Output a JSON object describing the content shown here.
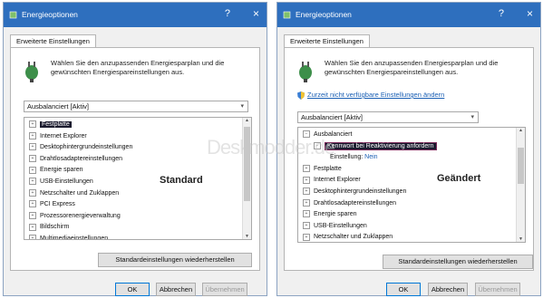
{
  "dialog_title": "Energieoptionen",
  "help_glyph": "?",
  "close_glyph": "×",
  "tab_label": "Erweiterte Einstellungen",
  "intro_text": "Wählen Sie den anzupassenden Energiesparplan und die gewünschten Energiespareinstellungen aus.",
  "link_text": "Zurzeit nicht verfügbare Einstellungen ändern",
  "plan_select": "Ausbalanciert [Aktiv]",
  "left_tree": [
    {
      "label": "Festplatte",
      "selected": true
    },
    {
      "label": "Internet Explorer"
    },
    {
      "label": "Desktophintergrundeinstellungen"
    },
    {
      "label": "Drahtlosadaptereinstellungen"
    },
    {
      "label": "Energie sparen"
    },
    {
      "label": "USB-Einstellungen"
    },
    {
      "label": "Netzschalter und Zuklappen"
    },
    {
      "label": "PCI Express"
    },
    {
      "label": "Prozessorenergieverwaltung"
    },
    {
      "label": "Bildschirm"
    },
    {
      "label": "Multimediaeinstellungen"
    }
  ],
  "right_tree": {
    "root": "Ausbalanciert",
    "child": "Kennwort bei Reaktivierung anfordern",
    "setting_label": "Einstellung:",
    "setting_value": "Nein",
    "items": [
      "Festplatte",
      "Internet Explorer",
      "Desktophintergrundeinstellungen",
      "Drahtlosadaptereinstellungen",
      "Energie sparen",
      "USB-Einstellungen",
      "Netzschalter und Zuklappen"
    ]
  },
  "label_left": "Standard",
  "label_right": "Geändert",
  "restore_button": "Standardeinstellungen wiederherstellen",
  "ok_button": "OK",
  "cancel_button": "Abbrechen",
  "apply_button": "Übernehmen",
  "watermark": "Deskmodder.de",
  "colors": {
    "titlebar": "#2e6fbe",
    "link": "#1a5fb4",
    "selection": "#1a1a2e"
  }
}
